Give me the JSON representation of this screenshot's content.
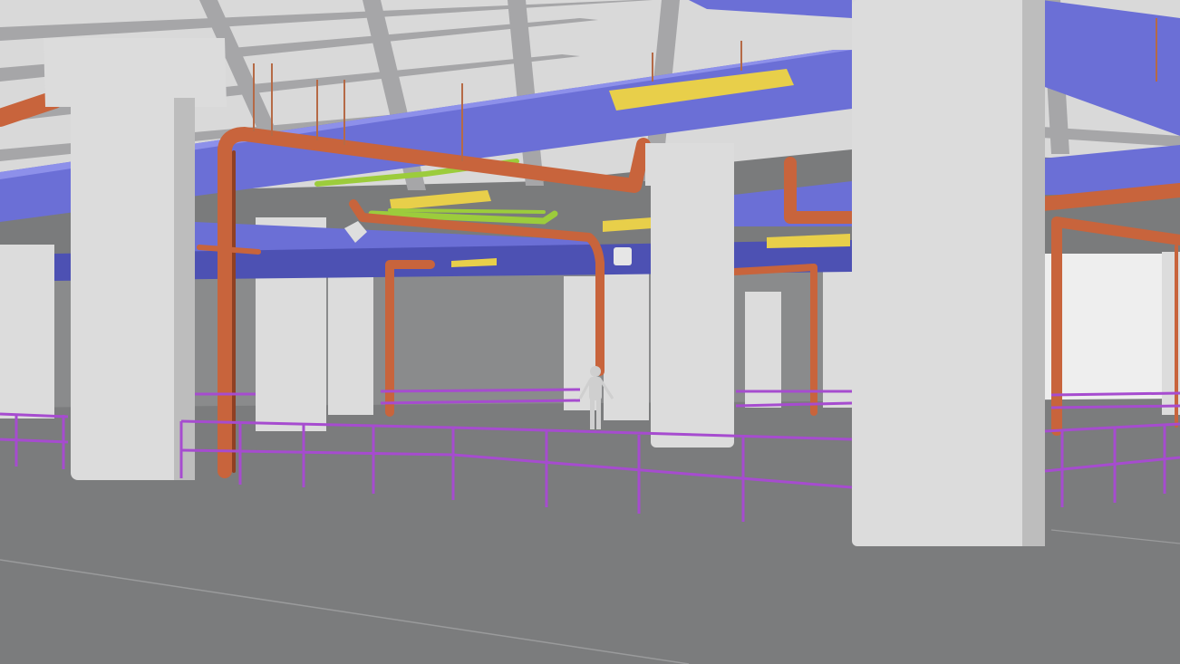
{
  "viewport": {
    "mode": "3d-view",
    "render_style": "shaded"
  },
  "colors": {
    "ceiling": "#d9d9d9",
    "ceiling_shadow": "#a6a6a8",
    "column": "#dcdcdc",
    "column_shade": "#bdbdbd",
    "floor": "#7b7c7d",
    "back_wall": "#8a8b8c",
    "right_wall": "#eeeeee",
    "duct": "#6b6fd6",
    "duct_light": "#8d90ea",
    "duct_dark": "#4d51b3",
    "pipe_orange": "#c8643c",
    "pipe_orange_dark": "#8f4023",
    "pipe_green": "#9ccc3c",
    "light_fixture": "#e8cf4a",
    "railing": "#a64ccf",
    "figure": "#cfcfcf"
  },
  "scene_objects": {
    "figure_count": 1,
    "column_count": 10,
    "light_fixture_count": 5
  }
}
